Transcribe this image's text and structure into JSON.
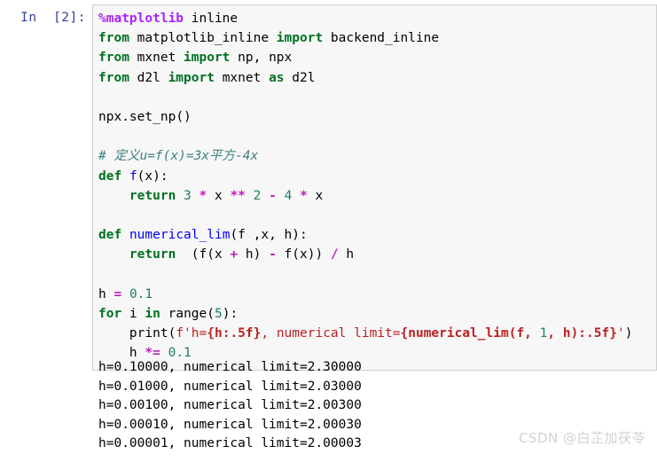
{
  "cell": {
    "prompt_label": "In  [2]:",
    "code_lines": [
      [
        {
          "t": "%matplotlib",
          "c": "magic"
        },
        {
          "t": " inline",
          "c": "plain"
        }
      ],
      [
        {
          "t": "from",
          "c": "kw"
        },
        {
          "t": " matplotlib_inline ",
          "c": "plain"
        },
        {
          "t": "import",
          "c": "kw"
        },
        {
          "t": " backend_inline",
          "c": "plain"
        }
      ],
      [
        {
          "t": "from",
          "c": "kw"
        },
        {
          "t": " mxnet ",
          "c": "plain"
        },
        {
          "t": "import",
          "c": "kw"
        },
        {
          "t": " np, npx",
          "c": "plain"
        }
      ],
      [
        {
          "t": "from",
          "c": "kw"
        },
        {
          "t": " d2l ",
          "c": "plain"
        },
        {
          "t": "import",
          "c": "kw"
        },
        {
          "t": " mxnet ",
          "c": "plain"
        },
        {
          "t": "as",
          "c": "kw"
        },
        {
          "t": " d2l",
          "c": "plain"
        }
      ],
      [],
      [
        {
          "t": "npx.",
          "c": "plain"
        },
        {
          "t": "set_np",
          "c": "plain"
        },
        {
          "t": "()",
          "c": "plain"
        }
      ],
      [],
      [
        {
          "t": "# 定义u=f(x)=3x平方-4x",
          "c": "comment"
        }
      ],
      [
        {
          "t": "def",
          "c": "kw"
        },
        {
          "t": " ",
          "c": "plain"
        },
        {
          "t": "f",
          "c": "func"
        },
        {
          "t": "(x):",
          "c": "plain"
        }
      ],
      [
        {
          "t": "    ",
          "c": "plain"
        },
        {
          "t": "return",
          "c": "kw"
        },
        {
          "t": " ",
          "c": "plain"
        },
        {
          "t": "3",
          "c": "num"
        },
        {
          "t": " ",
          "c": "plain"
        },
        {
          "t": "*",
          "c": "op"
        },
        {
          "t": " x ",
          "c": "plain"
        },
        {
          "t": "**",
          "c": "op"
        },
        {
          "t": " ",
          "c": "plain"
        },
        {
          "t": "2",
          "c": "num"
        },
        {
          "t": " ",
          "c": "plain"
        },
        {
          "t": "-",
          "c": "op"
        },
        {
          "t": " ",
          "c": "plain"
        },
        {
          "t": "4",
          "c": "num"
        },
        {
          "t": " ",
          "c": "plain"
        },
        {
          "t": "*",
          "c": "op"
        },
        {
          "t": " x",
          "c": "plain"
        }
      ],
      [],
      [
        {
          "t": "def",
          "c": "kw"
        },
        {
          "t": " ",
          "c": "plain"
        },
        {
          "t": "numerical_lim",
          "c": "func"
        },
        {
          "t": "(f ,x, h):",
          "c": "plain"
        }
      ],
      [
        {
          "t": "    ",
          "c": "plain"
        },
        {
          "t": "return",
          "c": "kw"
        },
        {
          "t": "  (f(x ",
          "c": "plain"
        },
        {
          "t": "+",
          "c": "op"
        },
        {
          "t": " h) ",
          "c": "plain"
        },
        {
          "t": "-",
          "c": "op"
        },
        {
          "t": " f(x)) ",
          "c": "plain"
        },
        {
          "t": "/",
          "c": "op"
        },
        {
          "t": " h",
          "c": "plain"
        }
      ],
      [],
      [
        {
          "t": "h ",
          "c": "plain"
        },
        {
          "t": "=",
          "c": "op"
        },
        {
          "t": " ",
          "c": "plain"
        },
        {
          "t": "0.1",
          "c": "num"
        }
      ],
      [
        {
          "t": "for",
          "c": "kw"
        },
        {
          "t": " i ",
          "c": "plain"
        },
        {
          "t": "in",
          "c": "kw"
        },
        {
          "t": " range(",
          "c": "plain"
        },
        {
          "t": "5",
          "c": "num"
        },
        {
          "t": "):",
          "c": "plain"
        }
      ],
      [
        {
          "t": "    print(",
          "c": "plain"
        },
        {
          "t": "f'",
          "c": "str"
        },
        {
          "t": "h=",
          "c": "str"
        },
        {
          "t": "{h:.5f}",
          "c": "strint"
        },
        {
          "t": ", numerical limit=",
          "c": "str"
        },
        {
          "t": "{numerical_lim(f, ",
          "c": "strint"
        },
        {
          "t": "1",
          "c": "num"
        },
        {
          "t": ", h):.5f}",
          "c": "strint"
        },
        {
          "t": "'",
          "c": "str"
        },
        {
          "t": ")",
          "c": "plain"
        }
      ],
      [
        {
          "t": "    h ",
          "c": "plain"
        },
        {
          "t": "*=",
          "c": "op"
        },
        {
          "t": " ",
          "c": "plain"
        },
        {
          "t": "0.1",
          "c": "num"
        }
      ]
    ],
    "output_lines": [
      "h=0.10000, numerical limit=2.30000",
      "h=0.01000, numerical limit=2.03000",
      "h=0.00100, numerical limit=2.00300",
      "h=0.00010, numerical limit=2.00030",
      "h=0.00001, numerical limit=2.00003"
    ]
  },
  "watermark": {
    "text": "CSDN @白芷加茯苓"
  },
  "colors": {
    "prompt": "#303f9f",
    "code_background": "#f7f7f7",
    "code_border": "#cfcfcf",
    "keyword": "#007020",
    "magic": "#aa22ff",
    "function": "#0000ff",
    "number": "#208050",
    "operator": "#bb22bb",
    "string": "#ba2121",
    "comment": "#408080",
    "watermark": "#d2d2d2"
  }
}
